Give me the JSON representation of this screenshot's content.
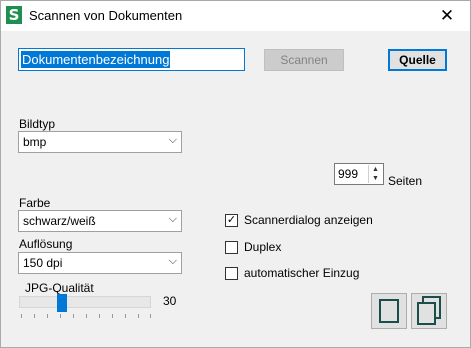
{
  "window": {
    "title": "Scannen von Dokumenten",
    "app_icon_letter": "S",
    "close_symbol": "✕"
  },
  "document": {
    "name": "Dokumentenbezeichnung"
  },
  "buttons": {
    "scan": "Scannen",
    "source": "Quelle"
  },
  "bildtyp": {
    "label": "Bildtyp",
    "value": "bmp"
  },
  "pages": {
    "value": "999",
    "label": "Seiten"
  },
  "farbe": {
    "label": "Farbe",
    "value": "schwarz/weiß"
  },
  "aufloesung": {
    "label": "Auflösung",
    "value": "150 dpi"
  },
  "jpg": {
    "label": "JPG-Qualität",
    "value": "30"
  },
  "options": {
    "scannerdialog": {
      "label": "Scannerdialog anzeigen",
      "checked": true
    },
    "duplex": {
      "label": "Duplex",
      "checked": false
    },
    "einzug": {
      "label": "automatischer Einzug",
      "checked": false
    }
  },
  "icons": {
    "chevron": "⌵",
    "spin_up": "▲",
    "spin_down": "▼",
    "check": "✓"
  },
  "colors": {
    "accent": "#0078d7",
    "app_icon": "#1e8f4e"
  }
}
